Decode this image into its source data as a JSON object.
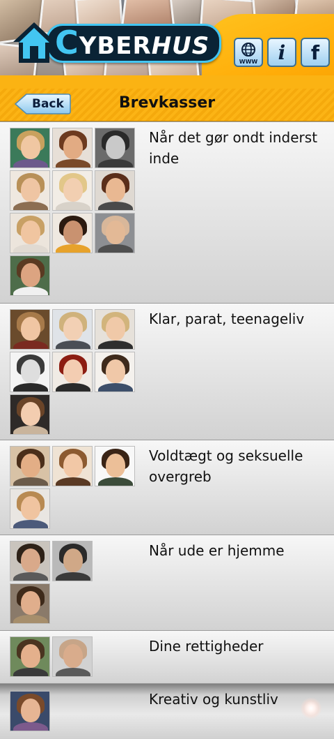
{
  "app": {
    "logo_text_c": "C",
    "logo_text_yber": "YBER",
    "logo_text_hus": "HUS",
    "www_label": "WWW",
    "info_label": "i",
    "facebook_label": "f"
  },
  "nav": {
    "back_label": "Back",
    "title": "Brevkasser"
  },
  "colors": {
    "accent_orange": "#fbb313",
    "logo_dark": "#0a2335",
    "logo_blue": "#43c6f2",
    "icon_blue": "#9fd0f0"
  },
  "rows": [
    {
      "label": "Når det gør ondt inderst inde",
      "thumb_count": 10
    },
    {
      "label": "Klar, parat, teenageliv",
      "thumb_count": 7
    },
    {
      "label": "Voldtægt og seksuelle overgreb",
      "thumb_count": 4
    },
    {
      "label": "Når ude er hjemme",
      "thumb_count": 3
    },
    {
      "label": "Dine rettigheder",
      "thumb_count": 2
    },
    {
      "label": "Kreativ og kunstliv",
      "thumb_count": 1
    }
  ]
}
